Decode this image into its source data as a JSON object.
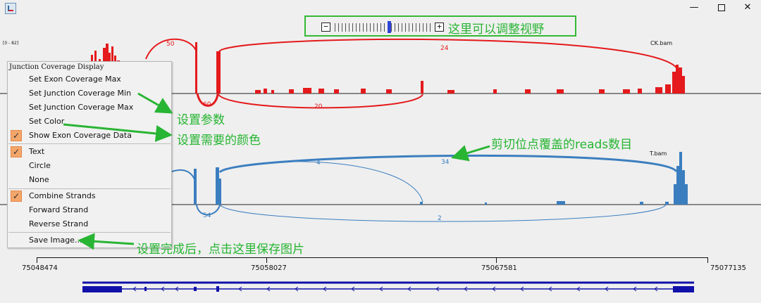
{
  "titlebar": {
    "app_icon": "java-icon",
    "minimize": "—",
    "close": "✕"
  },
  "zoom": {
    "minus_label": "−",
    "plus_label": "+",
    "annotation": "这里可以调整视野"
  },
  "tracks": {
    "range": "[0 - 82]",
    "ck_name": "CK.bam",
    "t_name": "T.bam",
    "ck_arcs": [
      "50",
      "24",
      "60",
      "20"
    ],
    "t_arcs": [
      "4",
      "34",
      "54",
      "2"
    ],
    "colors": {
      "ck": "#e41a1c",
      "t": "#3b7ebf"
    }
  },
  "menu": {
    "title": "Junction Coverage Display",
    "items": [
      {
        "label": "Set Exon Coverage Max",
        "checked": false
      },
      {
        "label": "Set Junction Coverage Min",
        "checked": false
      },
      {
        "label": "Set Junction Coverage Max",
        "checked": false
      },
      {
        "label": "Set Color",
        "checked": false
      },
      {
        "label": "Show Exon Coverage Data",
        "checked": true
      },
      {
        "label": "Text",
        "checked": true
      },
      {
        "label": "Circle",
        "checked": false
      },
      {
        "label": "None",
        "checked": false
      },
      {
        "label": "Combine Strands",
        "checked": true
      },
      {
        "label": "Forward Strand",
        "checked": false
      },
      {
        "label": "Reverse Strand",
        "checked": false
      },
      {
        "label": "Save Image...",
        "checked": false
      }
    ]
  },
  "annotations": {
    "set_params": "设置参数",
    "set_color": "设置需要的颜色",
    "reads": "剪切位点覆盖的reads数目",
    "save": "设置完成后，点击这里保存图片"
  },
  "ruler": {
    "labels": [
      "75048474",
      "75058027",
      "75067581",
      "75077135"
    ]
  }
}
